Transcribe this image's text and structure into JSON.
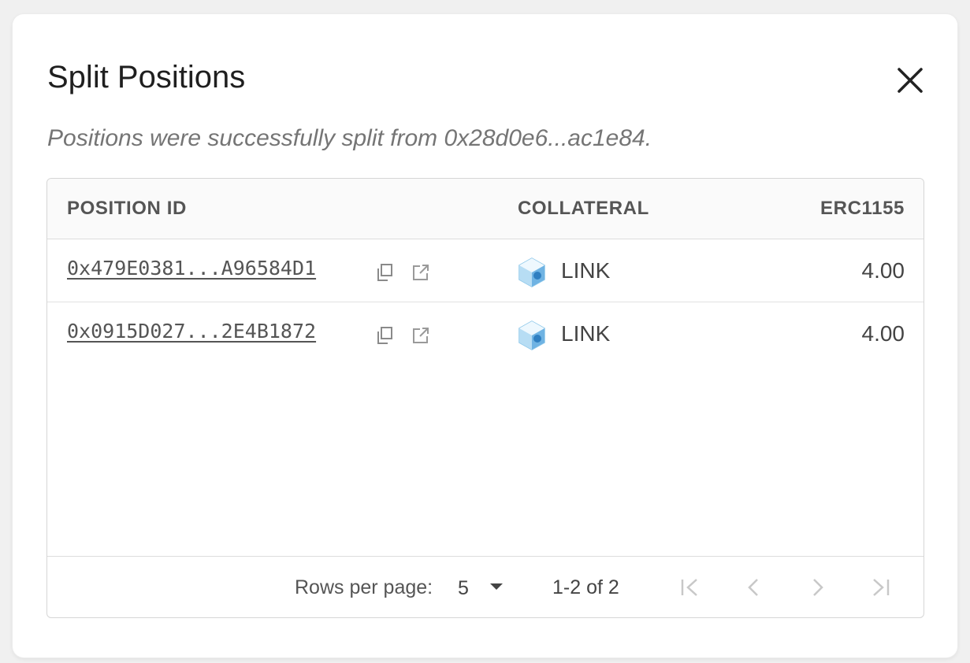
{
  "modal": {
    "title": "Split Positions",
    "subtitle": "Positions were successfully split from 0x28d0e6...ac1e84."
  },
  "icons": {
    "close": "close-icon",
    "copy": "copy-icon",
    "external": "external-link-icon",
    "token": "link-token-icon",
    "dropdown": "chevron-down-icon",
    "first": "first-page-icon",
    "prev": "previous-page-icon",
    "next": "next-page-icon",
    "last": "last-page-icon"
  },
  "table": {
    "headers": {
      "position_id": "POSITION ID",
      "collateral": "COLLATERAL",
      "erc1155": "ERC1155"
    },
    "rows": [
      {
        "position_id": "0x479E0381...A96584D1",
        "collateral": "LINK",
        "erc1155": "4.00"
      },
      {
        "position_id": "0x0915D027...2E4B1872",
        "collateral": "LINK",
        "erc1155": "4.00"
      }
    ]
  },
  "pagination": {
    "rows_per_page_label": "Rows per page:",
    "rows_per_page_value": "5",
    "range_text": "1-2 of 2"
  },
  "colors": {
    "link_text": "#555555",
    "subtitle": "#757575",
    "token_blue": "#6fb3e3"
  }
}
